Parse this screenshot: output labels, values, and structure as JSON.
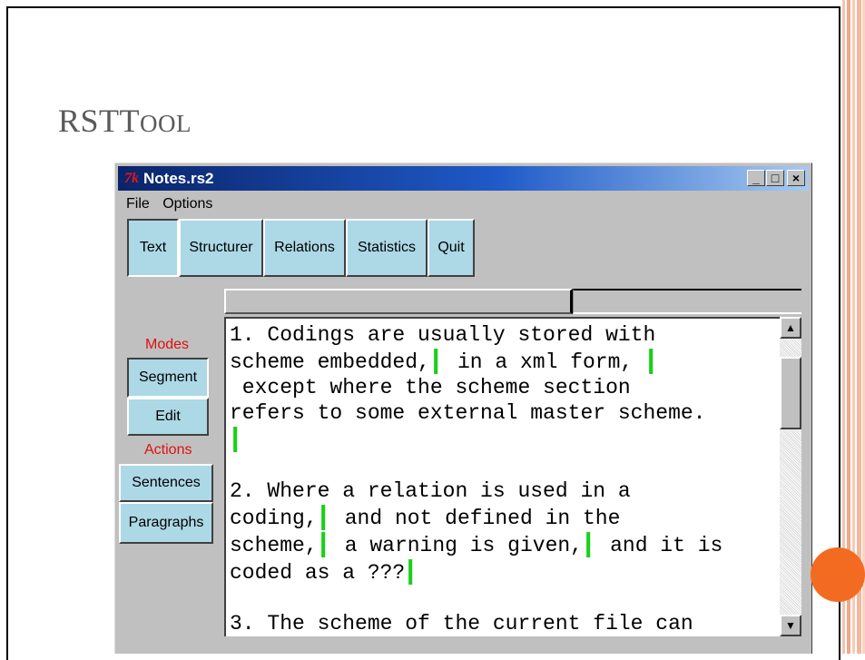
{
  "slide": {
    "title_first": "RST",
    "title_t": "T",
    "title_rest": "OOL"
  },
  "window": {
    "title": "Notes.rs2",
    "tk_icon": "7k",
    "controls": {
      "minimize": "_",
      "maximize": "□",
      "close": "×"
    }
  },
  "menu": {
    "items": [
      "File",
      "Options"
    ]
  },
  "toolbar": {
    "buttons": [
      "Text",
      "Structurer",
      "Relations",
      "Statistics",
      "Quit"
    ],
    "active": "Text"
  },
  "modes": {
    "label": "Modes",
    "buttons": [
      "Segment",
      "Edit"
    ],
    "active": "Segment"
  },
  "actions": {
    "label": "Actions",
    "buttons": [
      "Sentences",
      "Paragraphs"
    ]
  },
  "text_lines": [
    "1. Codings are usually stored with",
    "scheme embedded,",
    "in a xml form,",
    " except where the scheme section",
    "refers to some external master scheme.",
    "2. Where a relation is used in a",
    "coding,",
    "and not defined in the",
    "scheme,",
    "a warning is given,",
    "and it is",
    "coded as a ???",
    "3. The scheme of the current file can"
  ],
  "scrollbar": {
    "up_icon": "▲",
    "down_icon": "▼"
  },
  "colors": {
    "segment_marker": "#18d018",
    "button_bg": "#add8e6",
    "label_red": "#e01010",
    "accent_orange": "#f26b21"
  },
  "icons": [
    "window-app-icon",
    "minimize-icon",
    "maximize-icon",
    "close-icon",
    "scroll-up-arrow-icon",
    "scroll-down-arrow-icon",
    "segment-marker-icon"
  ]
}
